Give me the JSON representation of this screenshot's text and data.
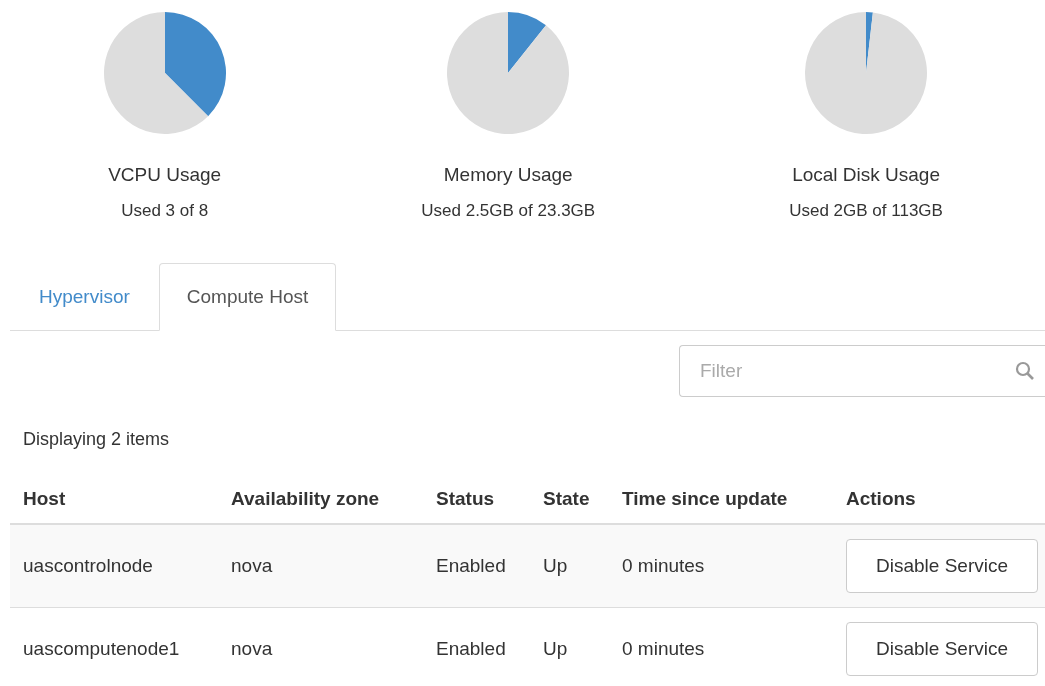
{
  "usage": [
    {
      "title": "VCPU Usage",
      "used": "Used 3 of 8",
      "chart_data": {
        "type": "pie",
        "values": [
          37.5,
          62.5
        ]
      }
    },
    {
      "title": "Memory Usage",
      "used": "Used 2.5GB of 23.3GB",
      "chart_data": {
        "type": "pie",
        "values": [
          10.7,
          89.3
        ]
      }
    },
    {
      "title": "Local Disk Usage",
      "used": "Used 2GB of 113GB",
      "chart_data": {
        "type": "pie",
        "values": [
          1.8,
          98.2
        ]
      }
    }
  ],
  "tabs": [
    {
      "label": "Hypervisor",
      "selected": false
    },
    {
      "label": "Compute Host",
      "selected": true
    }
  ],
  "filter": {
    "placeholder": "Filter"
  },
  "count": "Displaying 2 items",
  "table": {
    "columns": [
      "Host",
      "Availability zone",
      "Status",
      "State",
      "Time since update",
      "Actions"
    ],
    "rows": [
      {
        "cells": [
          "uascontrolnode",
          "nova",
          "Enabled",
          "Up",
          "0 minutes"
        ],
        "action": "Disable Service"
      },
      {
        "cells": [
          "uascomputenode1",
          "nova",
          "Enabled",
          "Up",
          "0 minutes"
        ],
        "action": "Disable Service"
      }
    ]
  }
}
